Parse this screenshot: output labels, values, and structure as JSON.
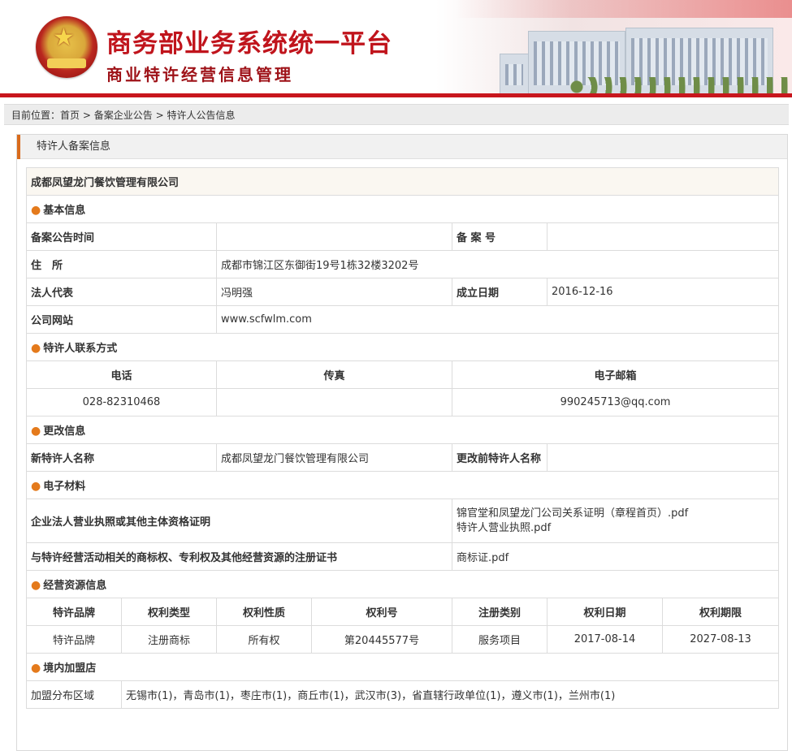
{
  "header": {
    "title": "商务部业务系统统一平台",
    "subtitle": "商业特许经营信息管理"
  },
  "breadcrumb": {
    "prefix": "目前位置：",
    "home": "首页",
    "sep": ">",
    "level2": "备案企业公告",
    "current": "特许人公告信息"
  },
  "panel": {
    "title": "特许人备案信息"
  },
  "company": {
    "name": "成都凤望龙门餐饮管理有限公司"
  },
  "basic": {
    "section_title": "基本信息",
    "announce_time_label": "备案公告时间",
    "announce_time_value": "",
    "record_no_label": "备 案 号",
    "record_no_value": "",
    "address_label": "住　所",
    "address_value": "成都市锦江区东御街19号1栋32楼3202号",
    "legal_rep_label": "法人代表",
    "legal_rep_value": "冯明强",
    "founded_label": "成立日期",
    "founded_value": "2016-12-16",
    "website_label": "公司网站",
    "website_value": "www.scfwlm.com"
  },
  "contact": {
    "section_title": "特许人联系方式",
    "phone_label": "电话",
    "fax_label": "传真",
    "email_label": "电子邮箱",
    "phone_value": "028-82310468",
    "fax_value": "",
    "email_value": "990245713@qq.com"
  },
  "change": {
    "section_title": "更改信息",
    "new_name_label": "新特许人名称",
    "new_name_value": "成都凤望龙门餐饮管理有限公司",
    "old_name_label": "更改前特许人名称",
    "old_name_value": ""
  },
  "materials": {
    "section_title": "电子材料",
    "license_label": "企业法人营业执照或其他主体资格证明",
    "license_files": [
      "锦官堂和凤望龙门公司关系证明（章程首页）.pdf",
      "特许人营业执照.pdf"
    ],
    "ip_label": "与特许经营活动相关的商标权、专利权及其他经营资源的注册证书",
    "ip_files": [
      "商标证.pdf"
    ]
  },
  "resources": {
    "section_title": "经营资源信息",
    "headers": [
      "特许品牌",
      "权利类型",
      "权利性质",
      "权利号",
      "注册类别",
      "权利日期",
      "权利期限"
    ],
    "rows": [
      [
        "特许品牌",
        "注册商标",
        "所有权",
        "第20445577号",
        "服务项目",
        "2017-08-14",
        "2027-08-13"
      ]
    ]
  },
  "franchise": {
    "section_title": "境内加盟店",
    "area_label": "加盟分布区域",
    "area_value": "无锡市(1)，青岛市(1)，枣庄市(1)，商丘市(1)，武汉市(3)，省直辖行政单位(1)，遵义市(1)，兰州市(1)"
  },
  "colors": {
    "brand_red": "#c0141c",
    "accent_orange": "#e47a1c",
    "link_red": "#cc1b1b"
  }
}
